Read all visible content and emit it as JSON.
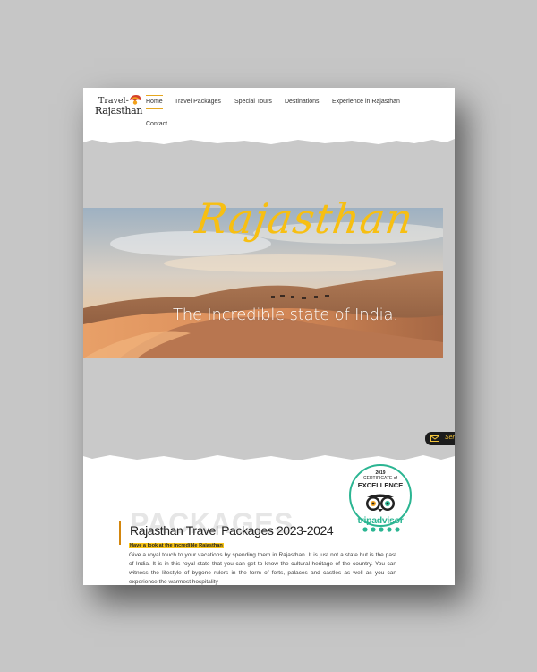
{
  "logo": {
    "line1": "Travel-",
    "line2": "Rajasthan"
  },
  "nav": {
    "items": [
      {
        "label": "Home",
        "active": true
      },
      {
        "label": "Travel Packages"
      },
      {
        "label": "Special Tours"
      },
      {
        "label": "Destinations"
      },
      {
        "label": "Experience in Rajasthan"
      },
      {
        "label": "Contact"
      }
    ]
  },
  "hero": {
    "title": "Rajasthan",
    "subtitle": "The Incredible state of India."
  },
  "send_tab": {
    "label": "Ser",
    "icon": "mail-icon"
  },
  "tripadvisor": {
    "year": "2019",
    "certificate": "CERTIFICATE of",
    "excellence": "EXCELLENCE",
    "brand": "tripadvisor"
  },
  "packages": {
    "background_word": "PACKAGES",
    "title": "Rajasthan Travel Packages 2023-2024",
    "highlight": "Have a look at the incredible Rajasthan",
    "body": "Give a royal touch to your vacations by spending them in Rajasthan. It is just not a state but is the past of India. It is in this royal state that you can get to know the cultural heritage of the country. You can witness the lifestyle of bygone rulers in the form of forts, palaces and castles as well as you can experience the warmest hospitality"
  },
  "colors": {
    "accent": "#f7bf12",
    "underline": "#e6a71f",
    "tripadvisor_green": "#2bb592"
  }
}
